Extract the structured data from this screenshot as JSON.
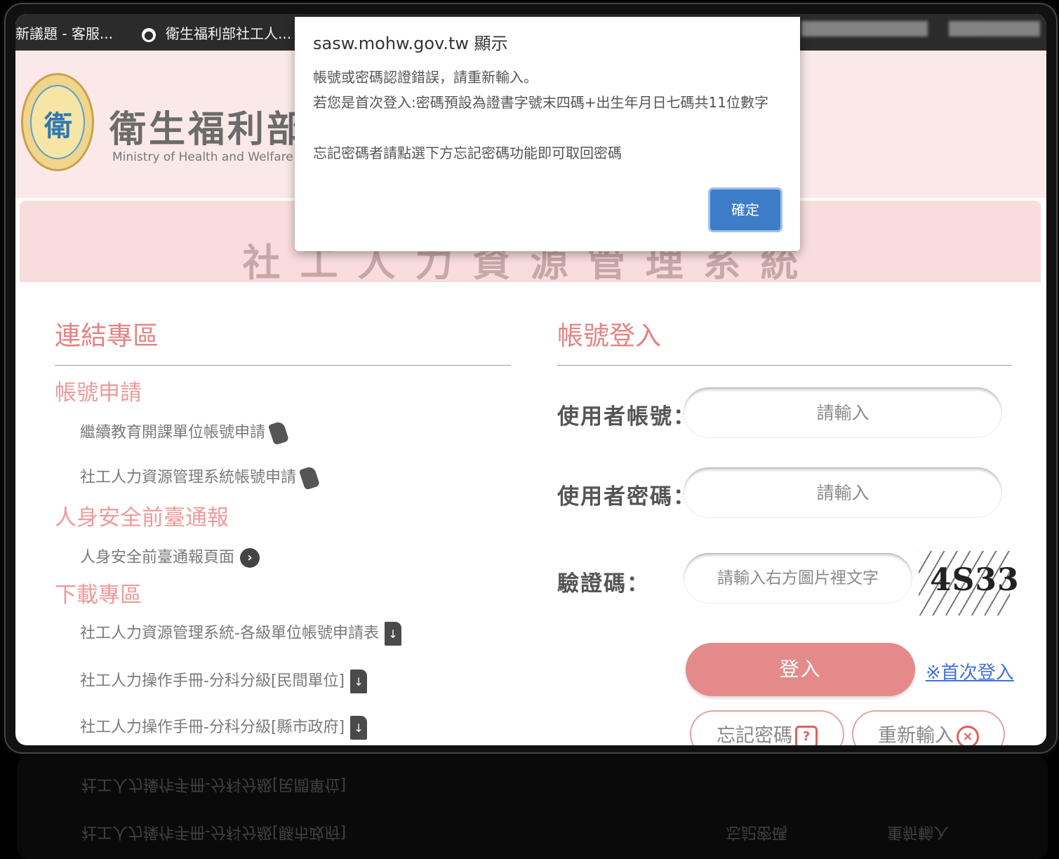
{
  "bookmarks": [
    {
      "label": "新議題 - 客服..."
    },
    {
      "label": "衛生福利部社工人..."
    }
  ],
  "header": {
    "brand_zh": "衛生福利部",
    "brand_en": "Ministry of Health and Welfare",
    "system_title": "社工人力資源管理系統"
  },
  "links": {
    "title": "連結專區",
    "sections": [
      {
        "title": "帳號申請",
        "items": [
          "繼續教育開課單位帳號申請",
          "社工人力資源管理系統帳號申請"
        ]
      },
      {
        "title": "人身安全前臺通報",
        "items": [
          "人身安全前臺通報頁面"
        ]
      },
      {
        "title": "下載專區",
        "items": [
          "社工人力資源管理系統-各級單位帳號申請表",
          "社工人力操作手冊-分科分級[民間單位]",
          "社工人力操作手冊-分科分級[縣市政府]"
        ]
      }
    ]
  },
  "login": {
    "title": "帳號登入",
    "username_label": "使用者帳號：",
    "username_placeholder": "請輸入",
    "password_label": "使用者密碼：",
    "password_placeholder": "請輸入",
    "captcha_label": "驗證碼：",
    "captcha_placeholder": "請輸入右方圖片裡文字",
    "captcha_text": "4S33",
    "login_button": "登入",
    "first_login_link": "※首次登入",
    "forgot_button": "忘記密碼",
    "reset_button": "重新輸入"
  },
  "dialog": {
    "title": "sasw.mohw.gov.tw 顯示",
    "lines": [
      "帳號或密碼認證錯誤，請重新輸入。",
      "若您是首次登入:密碼預設為證書字號末四碼+出生年月日七碼共11位數字",
      "忘記密碼者請點選下方忘記密碼功能即可取回密碼"
    ],
    "ok_button": "確定"
  },
  "colors": {
    "accent": "#e48484",
    "header_bg": "#fbe9ea",
    "dialog_button": "#3d7cc6"
  }
}
